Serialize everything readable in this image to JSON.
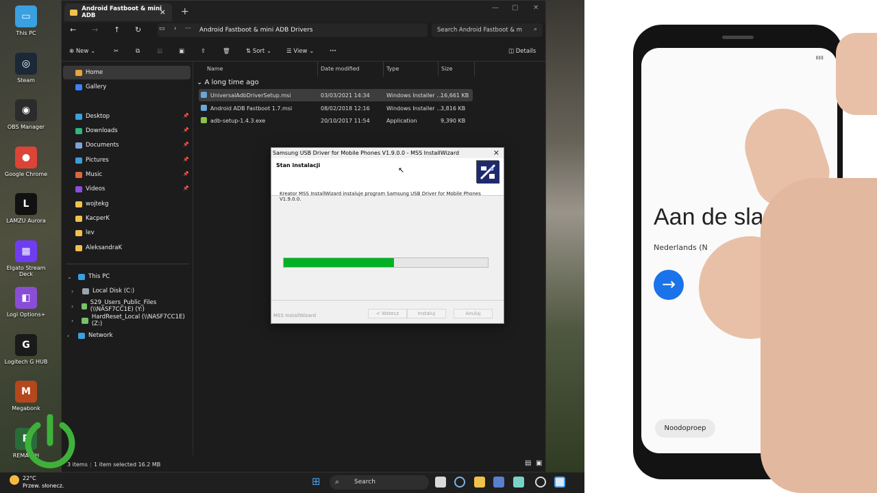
{
  "desktop_icons": [
    {
      "label": "This PC",
      "color": "#3aa0e0",
      "glyph": "▭"
    },
    {
      "label": "Steam",
      "color": "#1b2838",
      "glyph": "◎"
    },
    {
      "label": "OBS Manager",
      "color": "#2b2b2b",
      "glyph": "◉"
    },
    {
      "label": "Google Chrome",
      "color": "#db4437",
      "glyph": "●"
    },
    {
      "label": "LAMZU Aurora",
      "color": "#111111",
      "glyph": "L"
    },
    {
      "label": "Elgato Stream Deck",
      "color": "#6f3df0",
      "glyph": "▦"
    },
    {
      "label": "Logi Options+",
      "color": "#8a4ed6",
      "glyph": "◧"
    },
    {
      "label": "Logitech G HUB",
      "color": "#1a1a1a",
      "glyph": "G"
    },
    {
      "label": "Megabonk",
      "color": "#b4471b",
      "glyph": "M"
    },
    {
      "label": "REMATCH",
      "color": "#2a6b3a",
      "glyph": "R"
    }
  ],
  "explorer": {
    "tab_title": "Android Fastboot & mini ADB",
    "path": "Android Fastboot & mini ADB Drivers",
    "search_placeholder": "Search Android Fastboot & m",
    "toolbar": {
      "new": "New",
      "sort": "Sort",
      "view": "View",
      "details": "Details"
    },
    "nav": [
      {
        "label": "Home",
        "color": "#e8a33d",
        "pinned": false,
        "selected": true
      },
      {
        "label": "Gallery",
        "color": "#3b82f6",
        "pinned": false
      },
      {
        "label": "Desktop",
        "color": "#3aa0e0",
        "pinned": true
      },
      {
        "label": "Downloads",
        "color": "#2fb67b",
        "pinned": true
      },
      {
        "label": "Documents",
        "color": "#7fa3d6",
        "pinned": true
      },
      {
        "label": "Pictures",
        "color": "#3b9de0",
        "pinned": true
      },
      {
        "label": "Music",
        "color": "#e0663b",
        "pinned": true
      },
      {
        "label": "Videos",
        "color": "#8a4fe0",
        "pinned": true
      },
      {
        "label": "wojtekg",
        "color": "#f0c14b",
        "pinned": false
      },
      {
        "label": "KacperK",
        "color": "#f0c14b",
        "pinned": false
      },
      {
        "label": "lev",
        "color": "#f0c14b",
        "pinned": false
      },
      {
        "label": "AleksandraK",
        "color": "#f0c14b",
        "pinned": false
      }
    ],
    "tree": [
      {
        "label": "This PC",
        "color": "#3aa0e0"
      },
      {
        "label": "Local Disk (C:)",
        "color": "#9aa4ad"
      },
      {
        "label": "S29_Users_Public_Files (\\\\NASF7CC1E) (Y:)",
        "color": "#7cbf6a"
      },
      {
        "label": "HardReset_Local (\\\\NASF7CC1E) (Z:)",
        "color": "#7cbf6a"
      },
      {
        "label": "Network",
        "color": "#3aa0e0"
      }
    ],
    "columns": [
      "Name",
      "Date modified",
      "Type",
      "Size"
    ],
    "group": "A long time ago",
    "files": [
      {
        "name": "UniversalAdbDriverSetup.msi",
        "date": "03/03/2021 14:34",
        "type": "Windows Installer ...",
        "size": "16,661 KB",
        "color": "#6aa6d9"
      },
      {
        "name": "Android ADB Fastboot 1.7.msi",
        "date": "08/02/2018 12:16",
        "type": "Windows Installer ...",
        "size": "3,816 KB",
        "color": "#6aa6d9"
      },
      {
        "name": "adb-setup-1.4.3.exe",
        "date": "20/10/2017 11:54",
        "type": "Application",
        "size": "9,390 KB",
        "color": "#8bc34a"
      }
    ],
    "status": {
      "items": "3 items",
      "selected": "1 item selected  16.2 MB"
    }
  },
  "dialog": {
    "title": "Samsung USB Driver for Mobile Phones V1.9.0.0 - MSS InstallWizard",
    "heading": "Stan instalacji",
    "body": "Kreator MSS InstallWizard instaluje program Samsung USB Driver for Mobile Phones V1.9.0.0.",
    "progress": 0.54,
    "brand": "MSS InstallWizard",
    "back_label": "< Wstecz",
    "install_label": "Instaluj",
    "cancel_label": "Anuluj"
  },
  "taskbar": {
    "temperature": "22°C",
    "weather": "Przew. słonecz.",
    "search": "Search"
  },
  "phone": {
    "greeting": "Aan de slag!",
    "language": "Nederlands (N",
    "emergency": "Noodoproep"
  }
}
